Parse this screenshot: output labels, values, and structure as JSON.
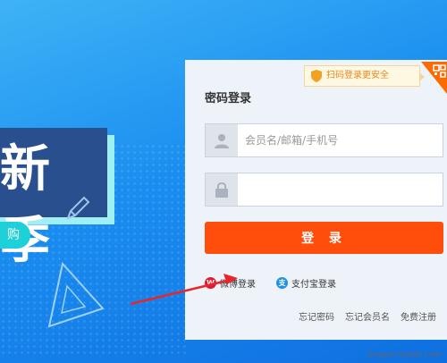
{
  "promo": {
    "headline": "新季",
    "badge": "购"
  },
  "login": {
    "qr_tip": "扫码登录更安全",
    "title": "密码登录",
    "username_placeholder": "会员名/邮箱/手机号",
    "username_value": "",
    "password_value": "",
    "submit_label": "登 录",
    "weibo_label": "微博登录",
    "alipay_label": "支付宝登录",
    "forgot_password": "忘记密码",
    "forgot_username": "忘记会员名",
    "register": "免费注册"
  },
  "watermark": "jingyan.baidu.com",
  "colors": {
    "accent": "#ff4d0c",
    "background_blue": "#1a8ef0",
    "tip_orange": "#e48b19"
  }
}
